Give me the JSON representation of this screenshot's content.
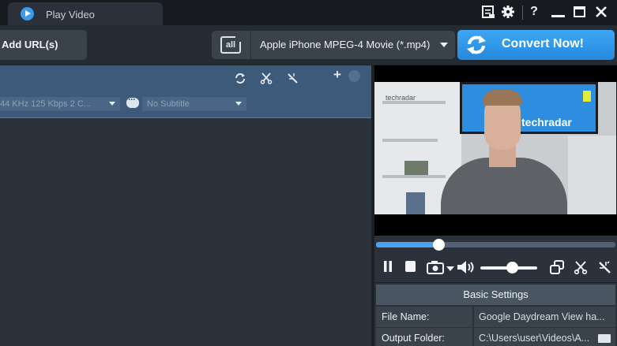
{
  "titlebar": {
    "tab_label": "Play Video",
    "help_label": "?",
    "minimize_label": "—",
    "maximize_label": "☐",
    "close_label": "✕"
  },
  "toolbar": {
    "add_url_label": "Add URL(s)",
    "format_icon_text": "all",
    "format_label": "Apple iPhone MPEG-4 Movie (*.mp4)",
    "convert_label": "Convert Now!"
  },
  "file_panel": {
    "audio_track": "44 KHz 125 Kbps 2 C...",
    "subtitle": "No Subtitle",
    "icons": [
      "refresh-icon",
      "cut-icon",
      "magic-wand-icon",
      "add-icon",
      "record-icon"
    ]
  },
  "preview": {
    "channel_badge": "techradar",
    "tv_text": "techradar",
    "seek_progress": 0.26,
    "volume_level": 0.55
  },
  "player": {
    "icons": [
      "pause-icon",
      "stop-icon",
      "snapshot-icon",
      "volume-icon",
      "copy-icon",
      "cut-icon",
      "magic-wand-icon"
    ]
  },
  "basic_settings": {
    "title": "Basic Settings",
    "rows": [
      {
        "key": "File Name:",
        "value": "Google Daydream View ha..."
      },
      {
        "key": "Output Folder:",
        "value": "C:\\Users\\user\\Videos\\A..."
      }
    ]
  },
  "colors": {
    "accent": "#3a9bea",
    "header_blue": "#3d5a7a",
    "background": "#2b323b"
  }
}
